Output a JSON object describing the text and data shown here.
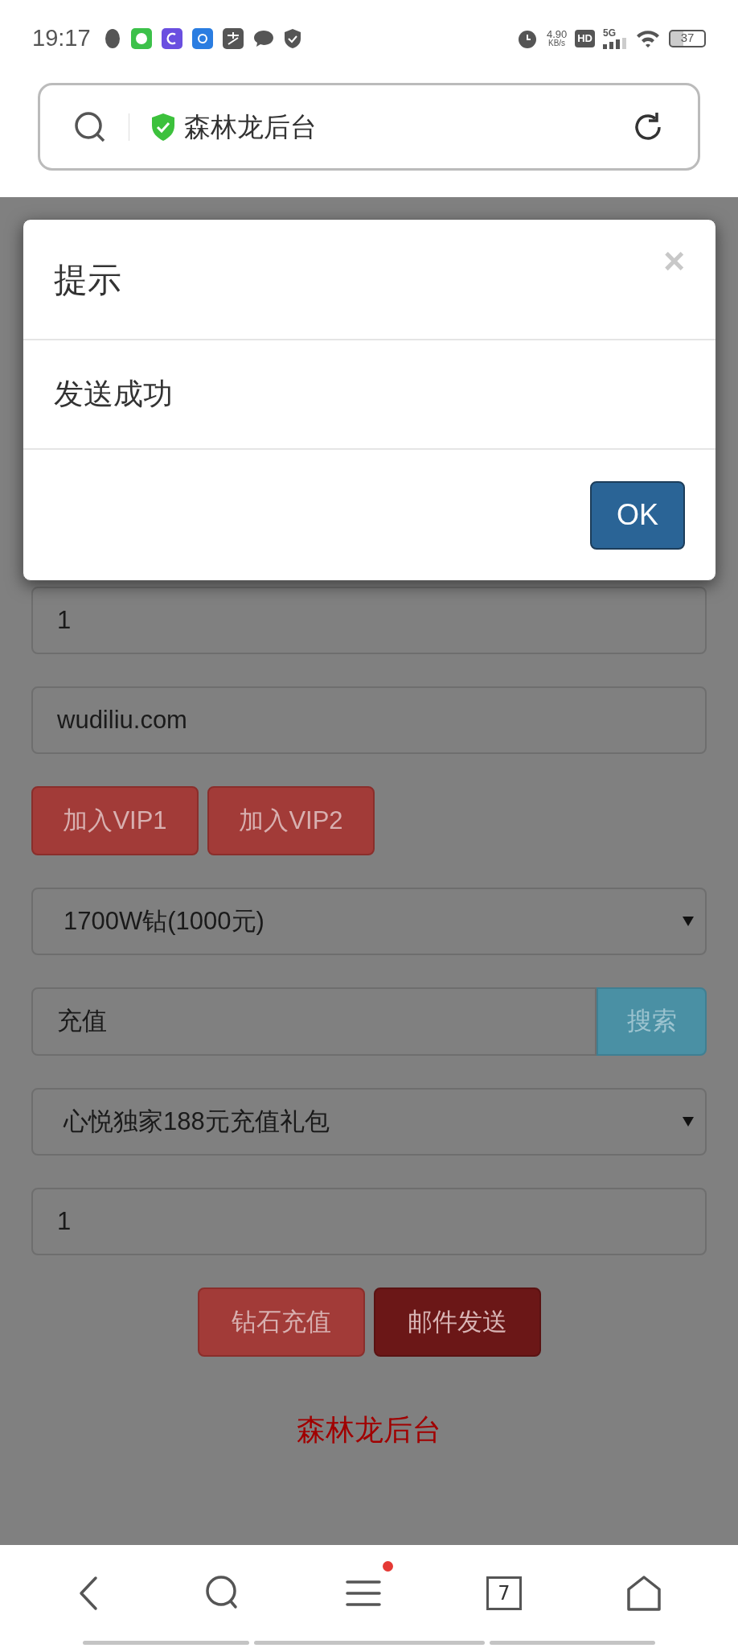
{
  "status_bar": {
    "time": "19:17",
    "net_speed": "4.90",
    "net_unit": "KB/s",
    "hd": "HD",
    "network": "5G",
    "battery": "37"
  },
  "address_bar": {
    "title": "森林龙后台"
  },
  "dialog": {
    "title": "提示",
    "close": "×",
    "message": "发送成功",
    "ok_button": "OK"
  },
  "form": {
    "items": [
      {
        "kind": "input",
        "value": "1"
      },
      {
        "kind": "input",
        "value": "wudiliu.com"
      },
      {
        "kind": "buttons",
        "buttons": [
          {
            "label": "加入VIP1",
            "kind": "normal"
          },
          {
            "label": "加入VIP2",
            "kind": "normal"
          }
        ]
      },
      {
        "kind": "select",
        "value": "1700W钻(1000元)"
      },
      {
        "kind": "search",
        "value": "充值",
        "button": "搜索"
      },
      {
        "kind": "select",
        "value": "心悦独家188元充值礼包"
      },
      {
        "kind": "input",
        "value": "1"
      },
      {
        "kind": "centered_buttons",
        "buttons": [
          {
            "label": "钻石充值",
            "kind": "normal"
          },
          {
            "label": "邮件发送",
            "kind": "pressed"
          }
        ]
      }
    ],
    "footer": "森林龙后台"
  },
  "bottom_nav": {
    "tab_count": "7",
    "menu_badge": true
  }
}
